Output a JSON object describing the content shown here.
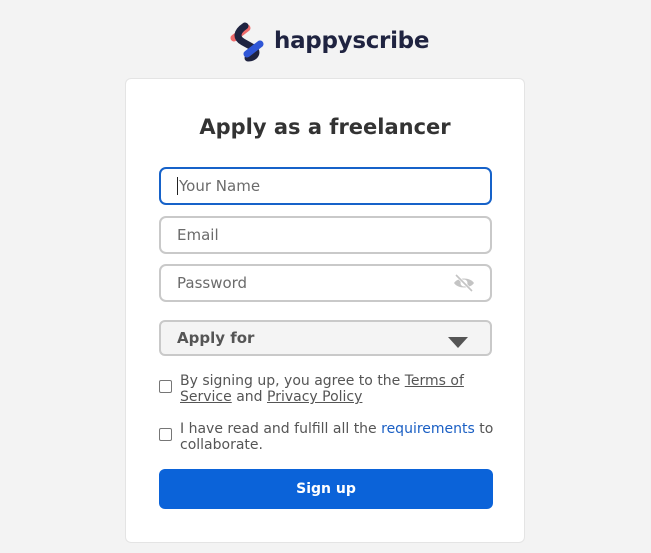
{
  "brand": {
    "name": "happyscribe",
    "logo_icon": "happyscribe-logo-icon",
    "colors": {
      "navy": "#1f2340",
      "blue": "#2f56d6",
      "coral": "#f06b6b"
    }
  },
  "form": {
    "title": "Apply as a freelancer",
    "name_placeholder": "Your Name",
    "email_placeholder": "Email",
    "password_placeholder": "Password",
    "password_toggle_icon": "eye-slash-icon",
    "apply_for_label": "Apply for",
    "apply_for_icon": "chevron-down-icon",
    "terms": {
      "prefix": "By signing up, you agree to the ",
      "terms_link": "Terms of Service",
      "middle": " and ",
      "privacy_link": "Privacy Policy"
    },
    "requirements": {
      "prefix": "I have read and fulfill all the ",
      "link": "requirements",
      "suffix": " to collaborate."
    },
    "signup_label": "Sign up",
    "accent_color": "#0b63d9"
  }
}
